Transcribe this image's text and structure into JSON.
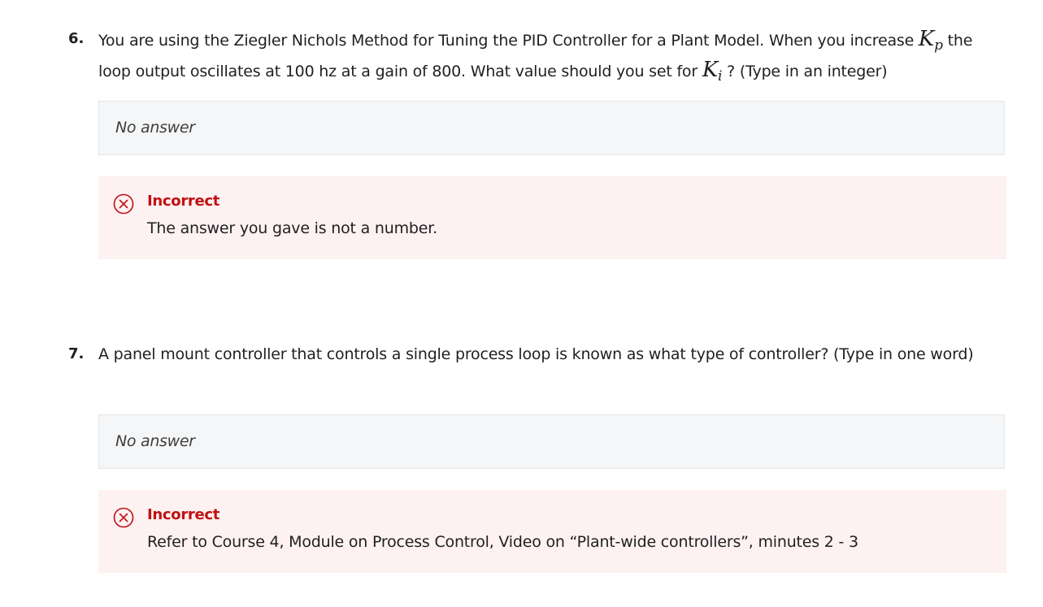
{
  "questions": [
    {
      "number": "6.",
      "text_part1": "You are using the Ziegler Nichols Method for Tuning the PID Controller for a Plant Model. When you increase ",
      "math1_base": "K",
      "math1_sub": "p",
      "text_part2": " the loop output oscillates at 100 hz at a gain of 800. What value should you set for ",
      "math2_base": "K",
      "math2_sub": "i",
      "text_part3": " ? (Type in an integer)",
      "answer": "No answer",
      "feedback_status": "Incorrect",
      "feedback_message": "The answer you gave is not a number."
    },
    {
      "number": "7.",
      "text": "A panel mount controller that controls a single process loop is known as what type of controller? (Type in one word)",
      "answer": "No answer",
      "feedback_status": "Incorrect",
      "feedback_message": "Refer to Course 4, Module on Process Control, Video on “Plant-wide controllers”, minutes 2 - 3"
    }
  ],
  "colors": {
    "incorrect": "#c01111",
    "feedback_bg": "#fdf1f2",
    "answer_bg": "#f5f6f7"
  },
  "icons": {
    "feedback": "close-circle-icon"
  }
}
